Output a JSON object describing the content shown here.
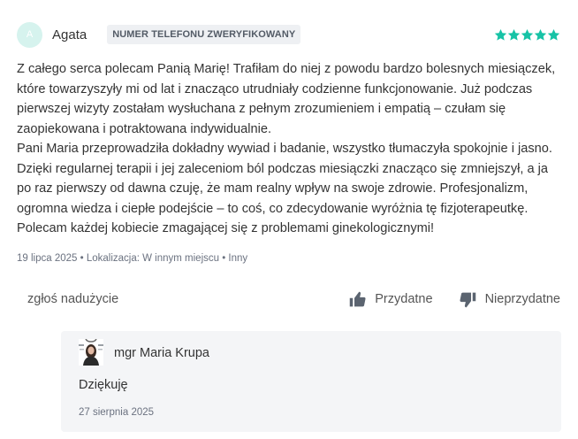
{
  "review": {
    "avatar_initial": "A",
    "author": "Agata",
    "badge": "NUMER TELEFONU ZWERYFIKOWANY",
    "rating": 5,
    "rating_max": 5,
    "star_color": "#17c3a6",
    "paragraphs": [
      "Z całego serca polecam Panią Marię! Trafiłam do niej z powodu bardzo bolesnych miesiączek, które towarzyszyły mi od lat i znacząco utrudniały codzienne funkcjonowanie. Już podczas pierwszej wizyty zostałam wysłuchana z pełnym zrozumieniem i empatią – czułam się zaopiekowana i potraktowana indywidualnie.",
      "Pani Maria przeprowadziła dokładny wywiad i badanie, wszystko tłumaczyła spokojnie i jasno. Dzięki regularnej terapii i jej zaleceniom ból podczas miesiączki znacząco się zmniejszył, a ja po raz pierwszy od dawna czuję, że mam realny wpływ na swoje zdrowie. Profesjonalizm, ogromna wiedza i ciepłe podejście – to coś, co zdecydowanie wyróżnia tę fizjoterapeutkę. Polecam każdej kobiecie zmagającej się z problemami ginekologicznymi!"
    ],
    "meta": "19 lipca 2025 • Lokalizacja: W innym miejscu • Inny"
  },
  "actions": {
    "report": "zgłoś nadużycie",
    "helpful": "Przydatne",
    "not_helpful": "Nieprzydatne"
  },
  "reply": {
    "name": "mgr Maria Krupa",
    "text": "Dziękuję",
    "date": "27 sierpnia 2025"
  }
}
